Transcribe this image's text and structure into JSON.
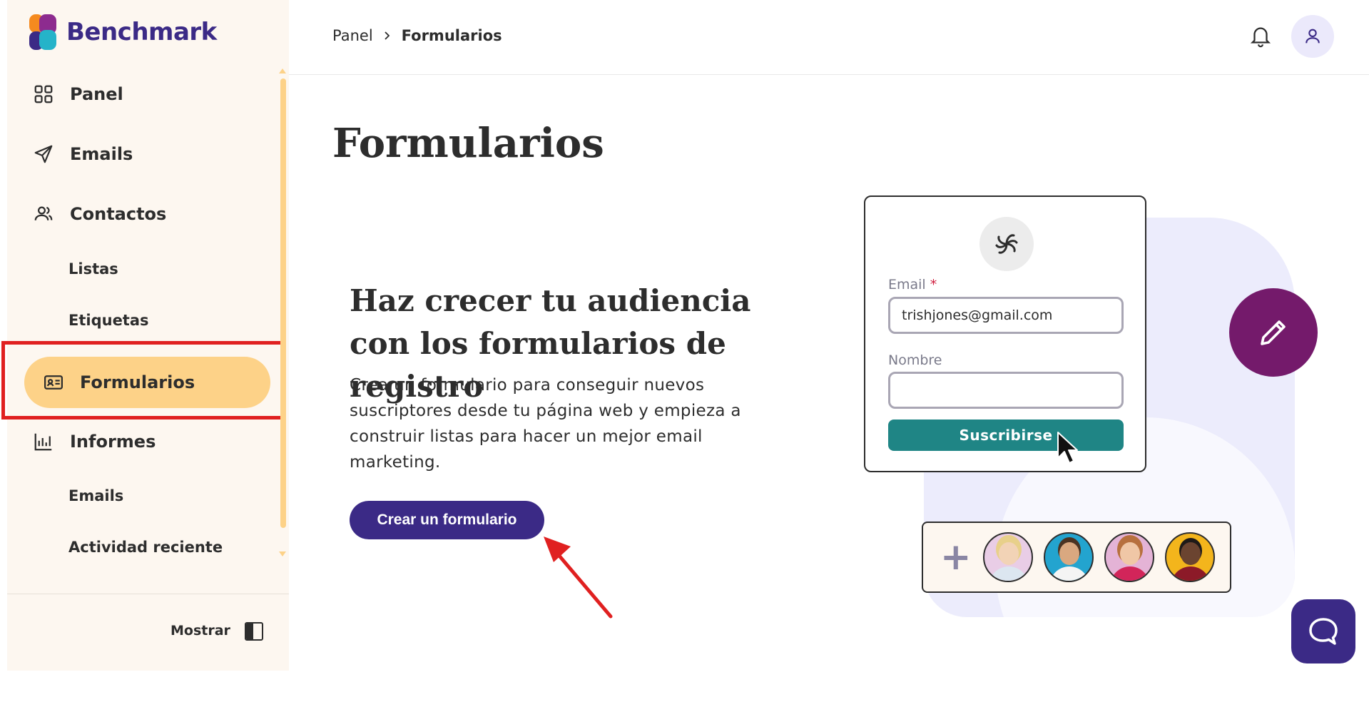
{
  "brand": {
    "name": "Benchmark",
    "colors": {
      "primary": "#3b2a86",
      "accent": "#fdd288",
      "teal": "#1f8585",
      "plum": "#741a6b"
    }
  },
  "sidebar": {
    "items": [
      {
        "label": "Panel",
        "icon": "grid-icon"
      },
      {
        "label": "Emails",
        "icon": "send-icon"
      },
      {
        "label": "Contactos",
        "icon": "users-icon"
      },
      {
        "label": "Listas"
      },
      {
        "label": "Etiquetas"
      },
      {
        "label": "Formularios",
        "icon": "id-card-icon",
        "active": true
      },
      {
        "label": "Informes",
        "icon": "bar-chart-icon"
      },
      {
        "label": "Emails"
      },
      {
        "label": "Actividad reciente"
      }
    ],
    "footer_label": "Mostrar"
  },
  "header": {
    "breadcrumb": [
      "Panel",
      "Formularios"
    ]
  },
  "main": {
    "title": "Formularios",
    "hero_title": "Haz crecer tu audiencia con los formularios de registro",
    "hero_description": "Crea un formulario para conseguir nuevos suscriptores desde tu página web y empieza a construir listas para hacer un mejor email marketing.",
    "cta_label": "Crear un formulario"
  },
  "illustration": {
    "email_label": "Email",
    "required_mark": "*",
    "email_value": "trishjones@gmail.com",
    "name_label": "Nombre",
    "name_value": "",
    "subscribe_label": "Suscribirse",
    "plus": "+"
  }
}
